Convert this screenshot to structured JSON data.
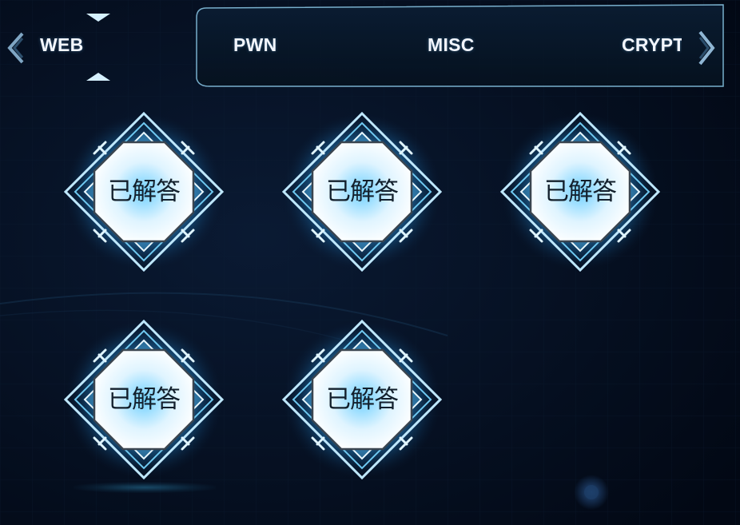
{
  "tabs": [
    {
      "label": "WEB",
      "active": true
    },
    {
      "label": "PWN",
      "active": false
    },
    {
      "label": "MISC",
      "active": false
    },
    {
      "label": "CRYPTO",
      "active": false
    }
  ],
  "challenges": [
    {
      "status": "已解答"
    },
    {
      "status": "已解答"
    },
    {
      "status": "已解答"
    },
    {
      "status": "已解答"
    },
    {
      "status": "已解答"
    }
  ],
  "icons": {
    "prev": "chevron-left-icon",
    "next": "chevron-right-icon"
  },
  "colors": {
    "background": "#020a1a",
    "glow": "#3fb8ff",
    "frame": "#bfe8ff",
    "tab_text": "#f2f6ff"
  }
}
